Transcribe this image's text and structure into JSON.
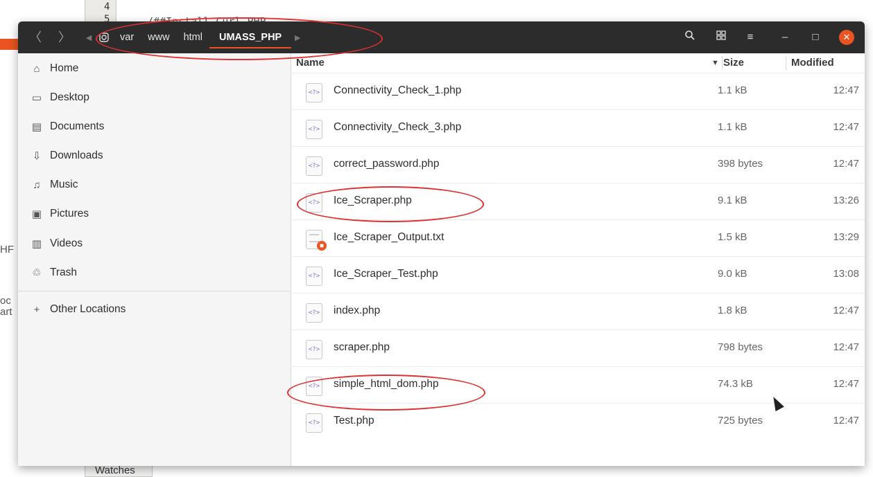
{
  "background": {
    "line_numbers": [
      "4",
      "5"
    ],
    "code_line": "/##Install Curl   PHP",
    "fragments": [
      "HF",
      "oc",
      "art"
    ],
    "bottom_tab": "Watches"
  },
  "header": {
    "back_icon": "chevron-left-icon",
    "forward_icon": "chevron-right-icon",
    "path": [
      "var",
      "www",
      "html",
      "UMASS_PHP"
    ],
    "root_icon": "disk-icon",
    "accent_color": "#e95420"
  },
  "sidebar": {
    "items": [
      {
        "label": "Home",
        "icon": "⌂"
      },
      {
        "label": "Desktop",
        "icon": "▭"
      },
      {
        "label": "Documents",
        "icon": "▤"
      },
      {
        "label": "Downloads",
        "icon": "⇩"
      },
      {
        "label": "Music",
        "icon": "♫"
      },
      {
        "label": "Pictures",
        "icon": "▣"
      },
      {
        "label": "Videos",
        "icon": "▥"
      },
      {
        "label": "Trash",
        "icon": "♲"
      }
    ],
    "other": {
      "label": "Other Locations",
      "icon": "+"
    }
  },
  "columns": {
    "name": "Name",
    "size": "Size",
    "modified": "Modified"
  },
  "files": [
    {
      "name": "Connectivity_Check_1.php",
      "size": "1.1 kB",
      "modified": "12:47",
      "type": "php"
    },
    {
      "name": "Connectivity_Check_3.php",
      "size": "1.1 kB",
      "modified": "12:47",
      "type": "php"
    },
    {
      "name": "correct_password.php",
      "size": "398 bytes",
      "modified": "12:47",
      "type": "php"
    },
    {
      "name": "Ice_Scraper.php",
      "size": "9.1 kB",
      "modified": "13:26",
      "type": "php"
    },
    {
      "name": "Ice_Scraper_Output.txt",
      "size": "1.5 kB",
      "modified": "13:29",
      "type": "txt"
    },
    {
      "name": "Ice_Scraper_Test.php",
      "size": "9.0 kB",
      "modified": "13:08",
      "type": "php"
    },
    {
      "name": "index.php",
      "size": "1.8 kB",
      "modified": "12:47",
      "type": "php"
    },
    {
      "name": "scraper.php",
      "size": "798 bytes",
      "modified": "12:47",
      "type": "php"
    },
    {
      "name": "simple_html_dom.php",
      "size": "74.3 kB",
      "modified": "12:47",
      "type": "php"
    },
    {
      "name": "Test.php",
      "size": "725 bytes",
      "modified": "12:47",
      "type": "php"
    }
  ],
  "file_icon_glyph": "<?>"
}
